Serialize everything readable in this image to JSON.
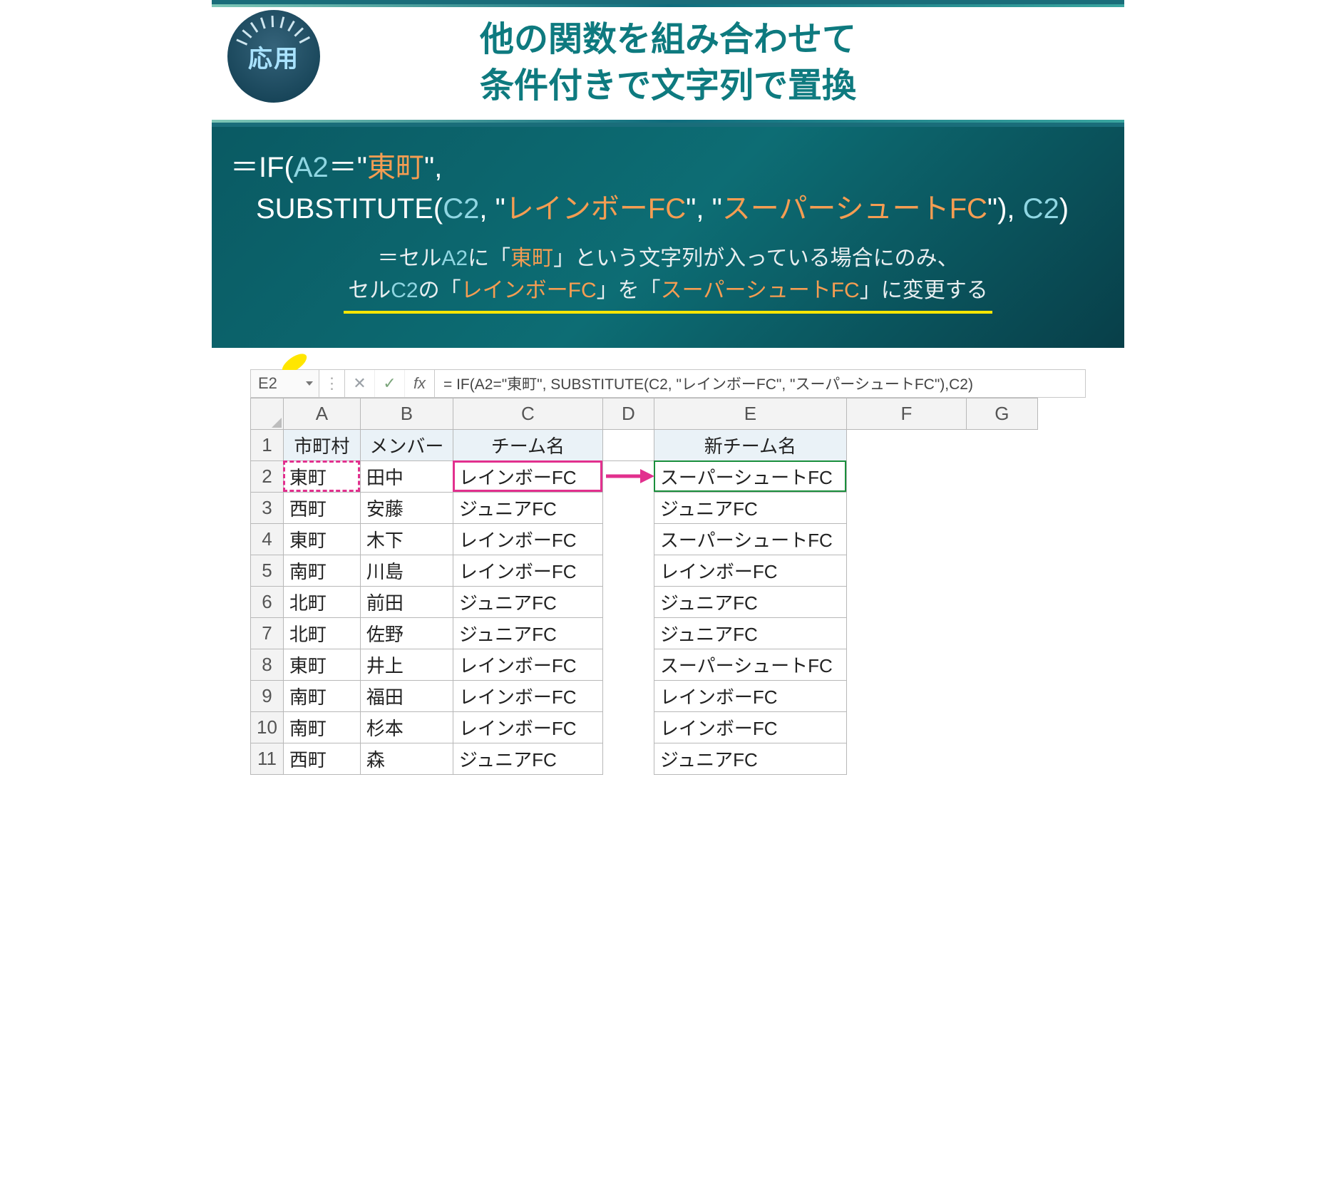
{
  "header": {
    "badge_label": "応用",
    "title_line1": "他の関数を組み合わせて",
    "title_line2": "条件付きで文字列で置換"
  },
  "formula": {
    "p1_lead": "＝IF(",
    "p1_cell": "A2",
    "p1_eq": "＝\"",
    "p1_val": "東町",
    "p1_tail": "\",",
    "p2_lead": "SUBSTITUTE(",
    "p2_cell": "C2",
    "p2_sep1": ", \"",
    "p2_old": "レインボーFC",
    "p2_sep2": "\", \"",
    "p2_new": "スーパーシュートFC",
    "p2_close": "\"), ",
    "p2_else": "C2",
    "p2_end": ")"
  },
  "explain": {
    "l1a": "＝セル",
    "l1cell": "A2",
    "l1b": "に「",
    "l1val": "東町",
    "l1c": "」という文字列が入っている場合にのみ、",
    "l2a": "セル",
    "l2cell": "C2",
    "l2b": "の「",
    "l2old": "レインボーFC",
    "l2c": "」を「",
    "l2new": "スーパーシュートFC",
    "l2d": "」に変更する"
  },
  "sheet": {
    "name_box": "E2",
    "fx_label": "fx",
    "formula_bar": "= IF(A2=\"東町\", SUBSTITUTE(C2, \"レインボーFC\", \"スーパーシュートFC\"),C2)",
    "col_labels": [
      "A",
      "B",
      "C",
      "D",
      "E",
      "F",
      "G"
    ],
    "headers": {
      "A": "市町村",
      "B": "メンバー",
      "C": "チーム名",
      "E": "新チーム名"
    },
    "rows": [
      {
        "n": "2",
        "A": "東町",
        "B": "田中",
        "C": "レインボーFC",
        "E": "スーパーシュートFC"
      },
      {
        "n": "3",
        "A": "西町",
        "B": "安藤",
        "C": "ジュニアFC",
        "E": "ジュニアFC"
      },
      {
        "n": "4",
        "A": "東町",
        "B": "木下",
        "C": "レインボーFC",
        "E": "スーパーシュートFC"
      },
      {
        "n": "5",
        "A": "南町",
        "B": "川島",
        "C": "レインボーFC",
        "E": "レインボーFC"
      },
      {
        "n": "6",
        "A": "北町",
        "B": "前田",
        "C": "ジュニアFC",
        "E": "ジュニアFC"
      },
      {
        "n": "7",
        "A": "北町",
        "B": "佐野",
        "C": "ジュニアFC",
        "E": "ジュニアFC"
      },
      {
        "n": "8",
        "A": "東町",
        "B": "井上",
        "C": "レインボーFC",
        "E": "スーパーシュートFC"
      },
      {
        "n": "9",
        "A": "南町",
        "B": "福田",
        "C": "レインボーFC",
        "E": "レインボーFC"
      },
      {
        "n": "10",
        "A": "南町",
        "B": "杉本",
        "C": "レインボーFC",
        "E": "レインボーFC"
      },
      {
        "n": "11",
        "A": "西町",
        "B": "森",
        "C": "ジュニアFC",
        "E": "ジュニアFC"
      }
    ]
  }
}
